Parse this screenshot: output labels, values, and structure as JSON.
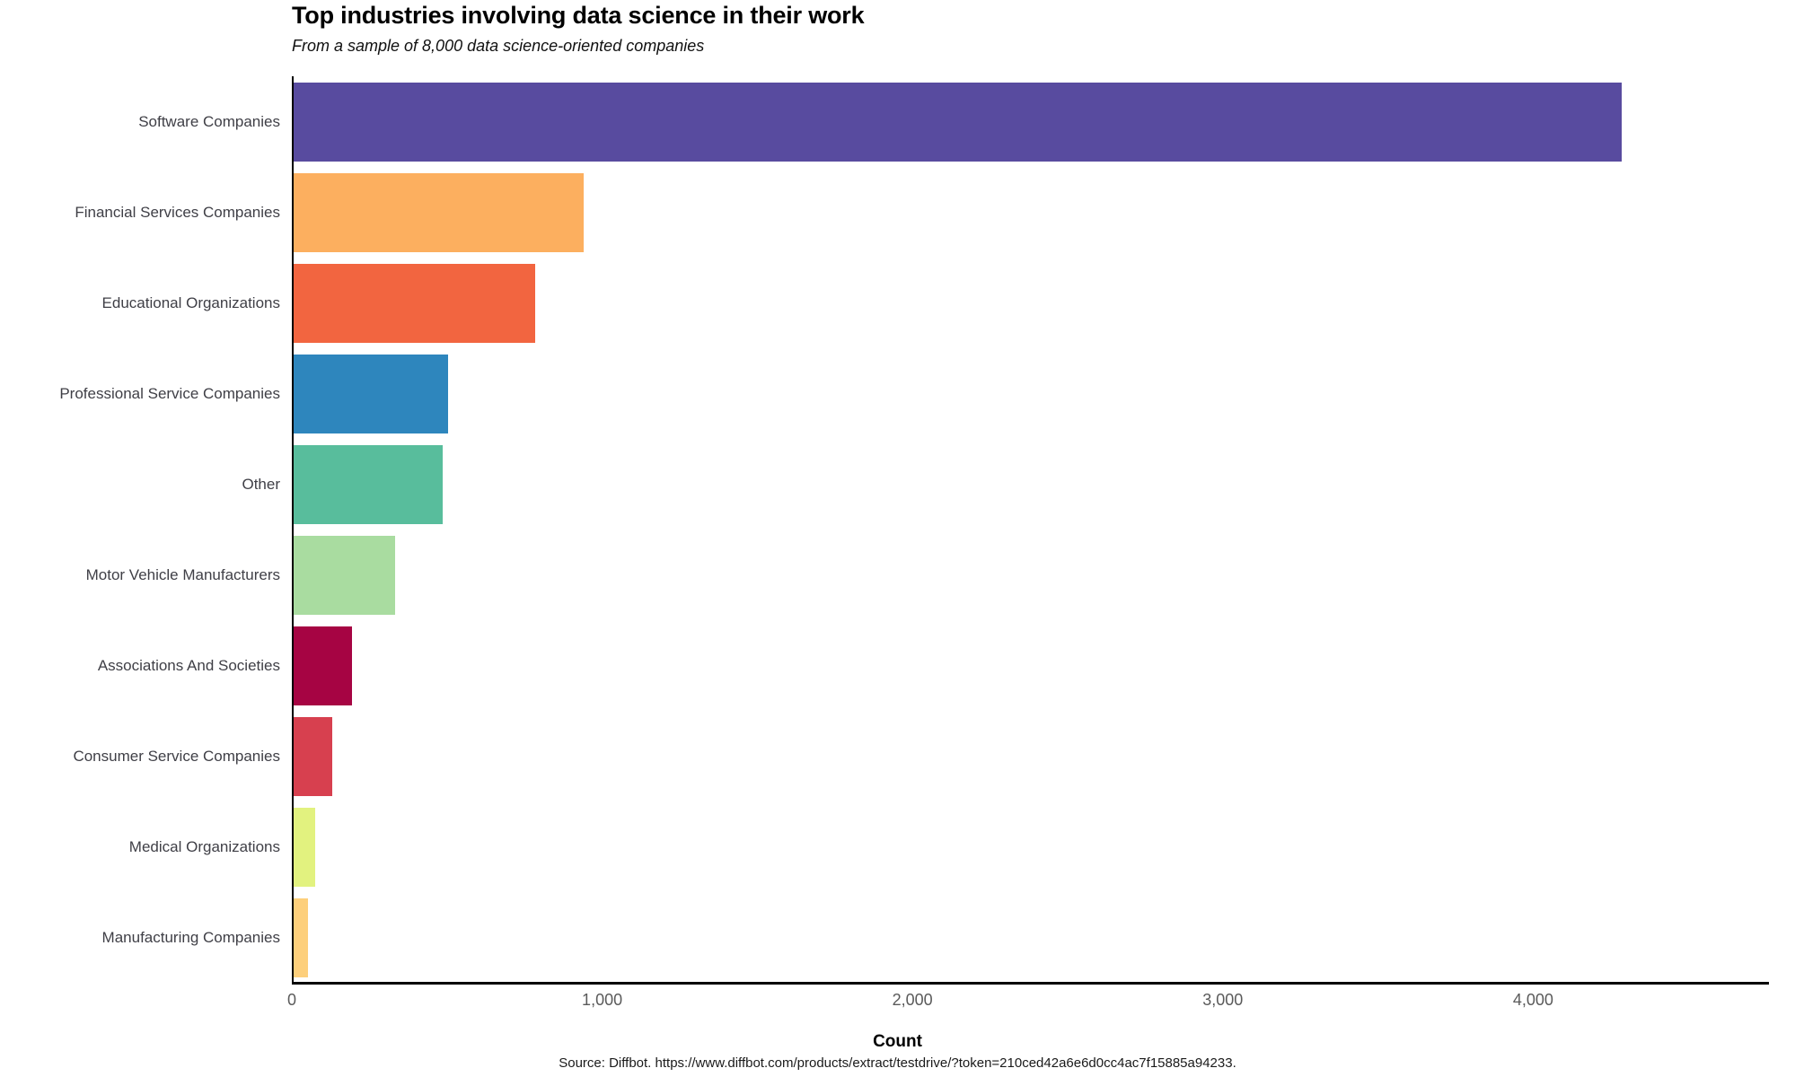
{
  "header": {
    "title": "Top industries involving data science in their work",
    "subtitle": "From a sample of 8,000 data science-oriented companies"
  },
  "footer": {
    "source": "Source: Diffbot. https://www.diffbot.com/products/extract/testdrive/?token=210ced42a6e6d0cc4ac7f15885a94233."
  },
  "chart_data": {
    "type": "bar",
    "orientation": "horizontal",
    "title": "Top industries involving data science in their work",
    "subtitle": "From a sample of 8,000 data science-oriented companies",
    "xlabel": "Count",
    "ylabel": "",
    "xlim": [
      0,
      4760
    ],
    "xticks": [
      0,
      1000,
      2000,
      3000,
      4000
    ],
    "xtick_labels": [
      "0",
      "1,000",
      "2,000",
      "3,000",
      "4,000"
    ],
    "grid": false,
    "legend": "none",
    "categories": [
      "Software Companies",
      "Financial Services Companies",
      "Educational Organizations",
      "Professional Service Companies",
      "Other",
      "Motor Vehicle Manufacturers",
      "Associations And Societies",
      "Consumer Service Companies",
      "Medical Organizations",
      "Manufacturing Companies"
    ],
    "values": [
      4281,
      934,
      778,
      497,
      480,
      327,
      188,
      124,
      70,
      45
    ],
    "colors": [
      "#584b9f",
      "#fcaf5f",
      "#f26540",
      "#2e86bd",
      "#58bd9c",
      "#a9dca0",
      "#a60443",
      "#d7404f",
      "#e2f27f",
      "#fdcf7b"
    ]
  }
}
